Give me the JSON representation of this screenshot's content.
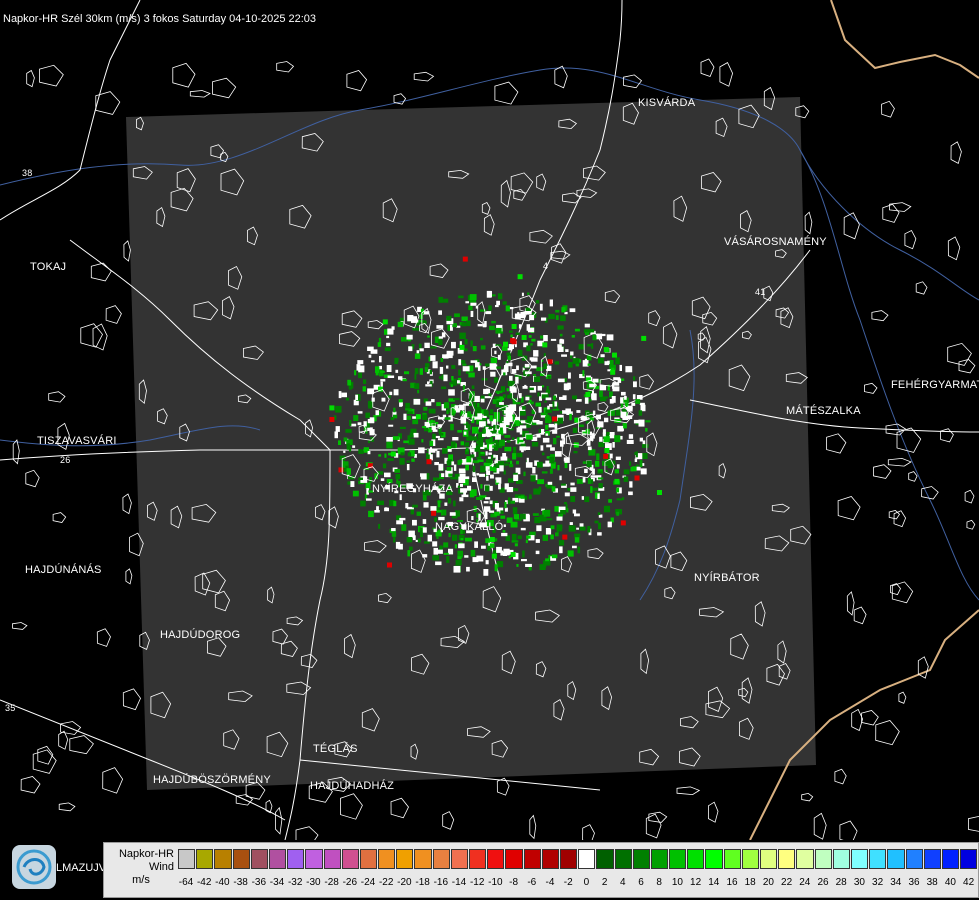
{
  "header": {
    "title": "Napkor-HR Szél 30km (m/s) 3 fokos Saturday 04-10-2025 22:03"
  },
  "cities": [
    {
      "name": "KISVÁRDA"
    },
    {
      "name": "VÁSÁROSNAMÉNY"
    },
    {
      "name": "TOKAJ"
    },
    {
      "name": "FEHÉRGYARMAT"
    },
    {
      "name": "MÁTÉSZALKA"
    },
    {
      "name": "TISZAVASVÁRI"
    },
    {
      "name": "NYÍREGYHÁZA"
    },
    {
      "name": "NAGYKÁLLÓ"
    },
    {
      "name": "NYÍRBÁTOR"
    },
    {
      "name": "HAJDÚNÁNÁS"
    },
    {
      "name": "HAJDÚDOROG"
    },
    {
      "name": "TÉGLÁS"
    },
    {
      "name": "HAJDÚBÖSZÖRMÉNY"
    },
    {
      "name": "HAJDÚHADHÁZ"
    }
  ],
  "road_numbers": [
    "38",
    "4",
    "41",
    "26",
    "35"
  ],
  "legend": {
    "line1": "Napkor-HR",
    "line2": "Wind",
    "line3": "m/s",
    "logo_text": "LMAZUJVÁR",
    "ticks": [
      "-64",
      "-42",
      "-40",
      "-38",
      "-36",
      "-34",
      "-32",
      "-30",
      "-28",
      "-26",
      "-24",
      "-22",
      "-20",
      "-18",
      "-16",
      "-14",
      "-12",
      "-10",
      "-8",
      "-6",
      "-4",
      "-2",
      "0",
      "2",
      "4",
      "6",
      "8",
      "10",
      "12",
      "14",
      "16",
      "18",
      "20",
      "22",
      "24",
      "26",
      "28",
      "30",
      "32",
      "34",
      "36",
      "38",
      "40",
      "42"
    ],
    "colors": [
      "#c8c8c8",
      "#a8a800",
      "#b88000",
      "#a85010",
      "#a05060",
      "#b050a0",
      "#a060f0",
      "#c060e0",
      "#c050c0",
      "#d05090",
      "#e07040",
      "#f09020",
      "#f0a000",
      "#f09020",
      "#e88040",
      "#f07050",
      "#f03020",
      "#f01010",
      "#e00000",
      "#c00000",
      "#b00000",
      "#a00000",
      "#ffffff",
      "#006000",
      "#007000",
      "#008000",
      "#00a000",
      "#00c000",
      "#00e000",
      "#00ff00",
      "#60ff20",
      "#a0ff40",
      "#e0ff80",
      "#ffff80",
      "#e0ffa0",
      "#c0ffc0",
      "#a0ffe0",
      "#80ffff",
      "#40e0ff",
      "#20c0ff",
      "#2080ff",
      "#1040ff",
      "#0020ff",
      "#0000e0"
    ],
    "accent_dark_area": "#333333"
  }
}
